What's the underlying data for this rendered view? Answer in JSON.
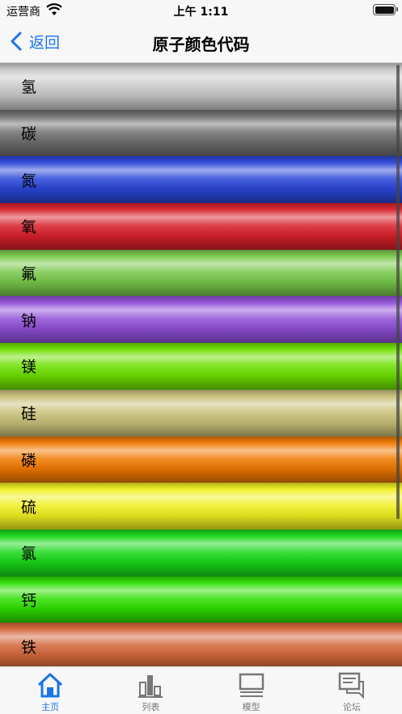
{
  "status_bar": {
    "carrier": "运营商",
    "time": "上午 1:11"
  },
  "nav": {
    "back_label": "返回",
    "title": "原子颜色代码"
  },
  "elements": [
    {
      "name": "氢",
      "color": "#c8c8c8",
      "text_color": "#000000"
    },
    {
      "name": "碳",
      "color": "#6e6e6e",
      "text_color": "#000000"
    },
    {
      "name": "氮",
      "color": "#2a45d8",
      "text_color": "#000000"
    },
    {
      "name": "氧",
      "color": "#d8202a",
      "text_color": "#000000"
    },
    {
      "name": "氟",
      "color": "#79c84a",
      "text_color": "#000000"
    },
    {
      "name": "钠",
      "color": "#8f4fd8",
      "text_color": "#000000"
    },
    {
      "name": "镁",
      "color": "#6de000",
      "text_color": "#000000"
    },
    {
      "name": "硅",
      "color": "#c8c078",
      "text_color": "#000000"
    },
    {
      "name": "磷",
      "color": "#f07800",
      "text_color": "#000000"
    },
    {
      "name": "硫",
      "color": "#f0f020",
      "text_color": "#000000"
    },
    {
      "name": "氯",
      "color": "#18d818",
      "text_color": "#000000"
    },
    {
      "name": "钙",
      "color": "#2ee000",
      "text_color": "#000000"
    },
    {
      "name": "铁",
      "color": "#d2663a",
      "text_color": "#000000"
    }
  ],
  "tabs": [
    {
      "label": "主页",
      "icon": "home-icon",
      "active": true
    },
    {
      "label": "列表",
      "icon": "list-icon",
      "active": false
    },
    {
      "label": "模型",
      "icon": "model-icon",
      "active": false
    },
    {
      "label": "论坛",
      "icon": "forum-icon",
      "active": false
    }
  ],
  "accent_color": "#1a73e8"
}
